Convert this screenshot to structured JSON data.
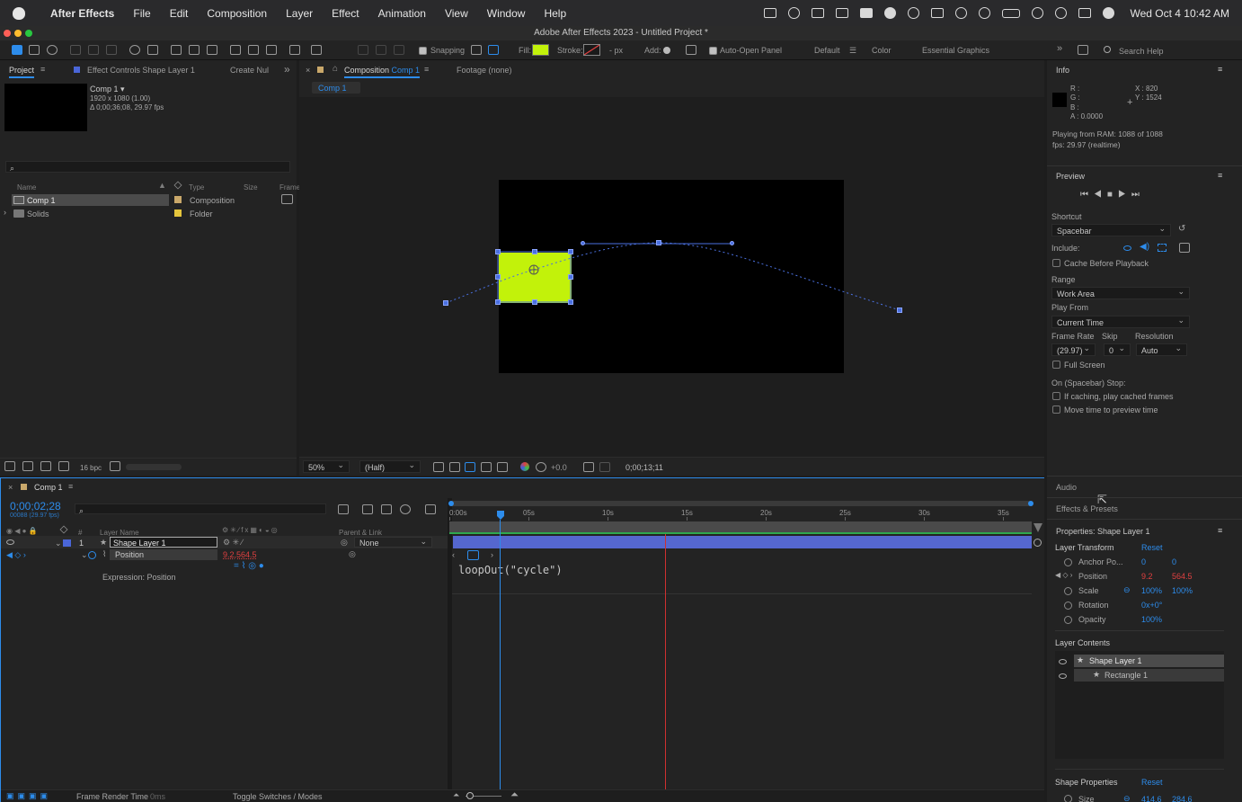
{
  "menubar": {
    "app": "After Effects",
    "items": [
      "File",
      "Edit",
      "Composition",
      "Layer",
      "Effect",
      "Animation",
      "View",
      "Window",
      "Help"
    ],
    "clock": "Wed Oct 4  10:42 AM"
  },
  "window": {
    "title": "Adobe After Effects 2023 - Untitled Project *"
  },
  "toolbar": {
    "snapping": "Snapping",
    "fill": "Fill:",
    "stroke": "Stroke:",
    "stroke_px": "- px",
    "add": "Add:",
    "auto_open": "Auto-Open Panel",
    "workspaces": [
      "Default",
      "Color",
      "Essential Graphics"
    ],
    "search_placeholder": "Search Help",
    "fill_color": "#c2f20a"
  },
  "project": {
    "tabs": [
      "Project",
      "Effect Controls Shape Layer 1",
      "Create Nul"
    ],
    "comp_name": "Comp 1 ▾",
    "comp_res": "1920 x 1080 (1.00)",
    "comp_dur": "Δ 0;00;36;08, 29.97 fps",
    "search_placeholder": "",
    "columns": [
      "Name",
      "Type",
      "Size",
      "Frame"
    ],
    "items": [
      {
        "name": "Comp 1",
        "type": "Composition"
      },
      {
        "name": "Solids",
        "type": "Folder"
      }
    ],
    "bpc": "16 bpc"
  },
  "viewer": {
    "tab_prefix": "Composition",
    "tab_comp": "Comp 1",
    "footage": "Footage (none)",
    "breadcrumb": "Comp 1",
    "zoom": "50%",
    "resolution": "(Half)",
    "exposure": "+0.0",
    "timecode": "0;00;13;11"
  },
  "timeline": {
    "tab": "Comp 1",
    "timecode": "0;00;02;28",
    "frames": "00088 (29.97 fps)",
    "col_layer": "Layer Name",
    "col_parent": "Parent & Link",
    "col_num": "#",
    "layer_num": "1",
    "layer_name": "Shape Layer 1",
    "parent": "None",
    "prop_name": "Position",
    "prop_value": "9.2,564.5",
    "expression_label": "Expression: Position",
    "expression": "loopOut(\"cycle\")",
    "ruler": [
      "0:00s",
      "05s",
      "10s",
      "15s",
      "20s",
      "25s",
      "30s",
      "35s"
    ],
    "footer_render": "Frame Render Time",
    "footer_ms": "0ms",
    "footer_toggle": "Toggle Switches / Modes"
  },
  "info": {
    "title": "Info",
    "r": "R :",
    "g": "G :",
    "b": "B :",
    "a": "A :  0.0000",
    "x": "X : 820",
    "y": "Y : 1524",
    "playing": "Playing from RAM: 1088 of 1088",
    "fps": "fps: 29.97 (realtime)"
  },
  "preview": {
    "title": "Preview",
    "shortcut_label": "Shortcut",
    "shortcut": "Spacebar",
    "include": "Include:",
    "cache": "Cache Before Playback",
    "range_label": "Range",
    "range": "Work Area",
    "play_from_label": "Play From",
    "play_from": "Current Time",
    "frame_rate_label": "Frame Rate",
    "skip_label": "Skip",
    "resolution_label": "Resolution",
    "frame_rate": "(29.97)",
    "skip": "0",
    "resolution": "Auto",
    "full_screen": "Full Screen",
    "on_stop": "On (Spacebar) Stop:",
    "if_caching": "If caching, play cached frames",
    "move_time": "Move time to preview time"
  },
  "audio": {
    "title": "Audio"
  },
  "effects": {
    "title": "Effects & Presets"
  },
  "properties": {
    "title": "Properties: Shape Layer 1",
    "transform": "Layer Transform",
    "reset": "Reset",
    "rows": [
      {
        "name": "Anchor Po...",
        "v1": "0",
        "v2": "0"
      },
      {
        "name": "Position",
        "v1": "9.2",
        "v2": "564.5"
      },
      {
        "name": "Scale",
        "v1": "100%",
        "v2": "100%"
      },
      {
        "name": "Rotation",
        "v1": "0x+0°",
        "v2": ""
      },
      {
        "name": "Opacity",
        "v1": "100%",
        "v2": ""
      }
    ],
    "contents": "Layer Contents",
    "contents_items": [
      "Shape Layer 1",
      "Rectangle 1"
    ],
    "shape_props": "Shape Properties",
    "shape_reset": "Reset",
    "size_label": "Size",
    "size_v1": "414.6",
    "size_v2": "284.6"
  }
}
